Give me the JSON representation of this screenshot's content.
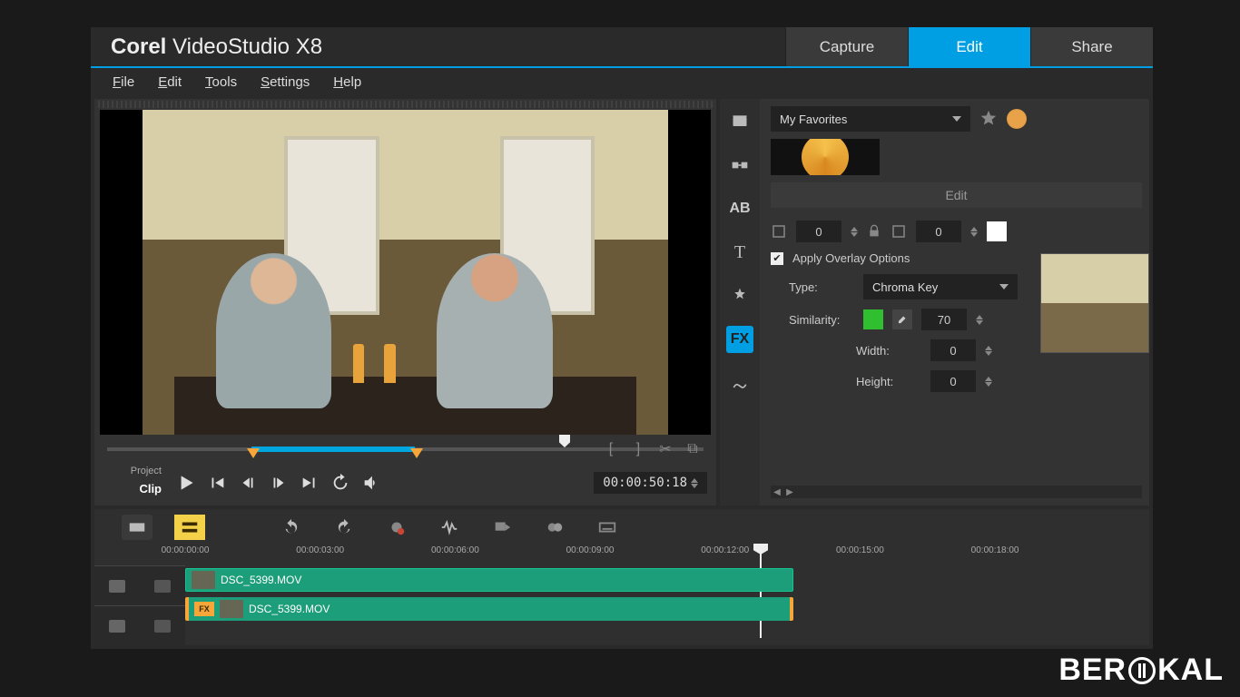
{
  "app": {
    "title_brand": "Corel",
    "title_product": "VideoStudio X8"
  },
  "tabs": {
    "capture": "Capture",
    "edit": "Edit",
    "share": "Share",
    "active": "edit"
  },
  "menu": {
    "file": "File",
    "edit": "Edit",
    "tools": "Tools",
    "settings": "Settings",
    "help": "Help"
  },
  "preview": {
    "project_label": "Project",
    "clip_label": "Clip",
    "timecode": "00:00:50:18"
  },
  "library": {
    "dropdown": "My Favorites",
    "edit_button": "Edit"
  },
  "overlay": {
    "border_value1": "0",
    "border_value2": "0",
    "apply_label": "Apply Overlay Options",
    "type_label": "Type:",
    "type_value": "Chroma Key",
    "similarity_label": "Similarity:",
    "similarity_value": "70",
    "width_label": "Width:",
    "width_value": "0",
    "height_label": "Height:",
    "height_value": "0"
  },
  "sidetabs": {
    "fx": "FX"
  },
  "timeline": {
    "ticks": [
      "00:00:00:00",
      "00:00:03:00",
      "00:00:06:00",
      "00:00:09:00",
      "00:00:12:00",
      "00:00:15:00",
      "00:00:18:00"
    ],
    "clip1": "DSC_5399.MOV",
    "clip2": "DSC_5399.MOV",
    "fx_badge": "FX"
  },
  "watermark": {
    "part1": "BER",
    "part2": "KAL"
  }
}
